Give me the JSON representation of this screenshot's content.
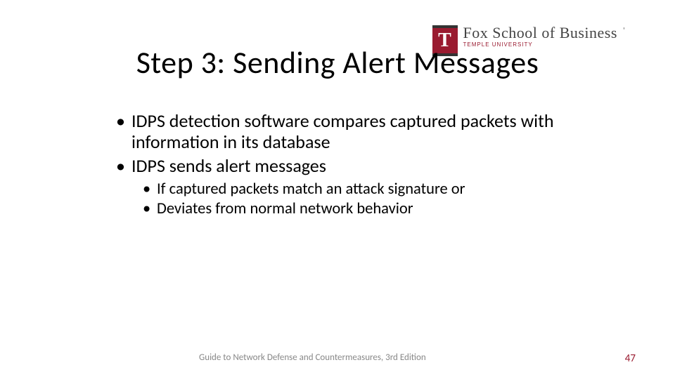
{
  "logo": {
    "mark_letter": "T",
    "line1": "Fox School of Business",
    "line2": "TEMPLE UNIVERSITY",
    "reg": "®"
  },
  "title": "Step 3: Sending Alert Messages",
  "bullets": {
    "b1a": "IDPS detection software compares captured packets with information in its database",
    "b1b": "IDPS sends alert messages",
    "b2a": "If captured packets match an attack signature or",
    "b2b": "Deviates from normal network behavior"
  },
  "footer": {
    "text": "Guide to Network Defense and Countermeasures, 3rd Edition",
    "page": "47"
  }
}
